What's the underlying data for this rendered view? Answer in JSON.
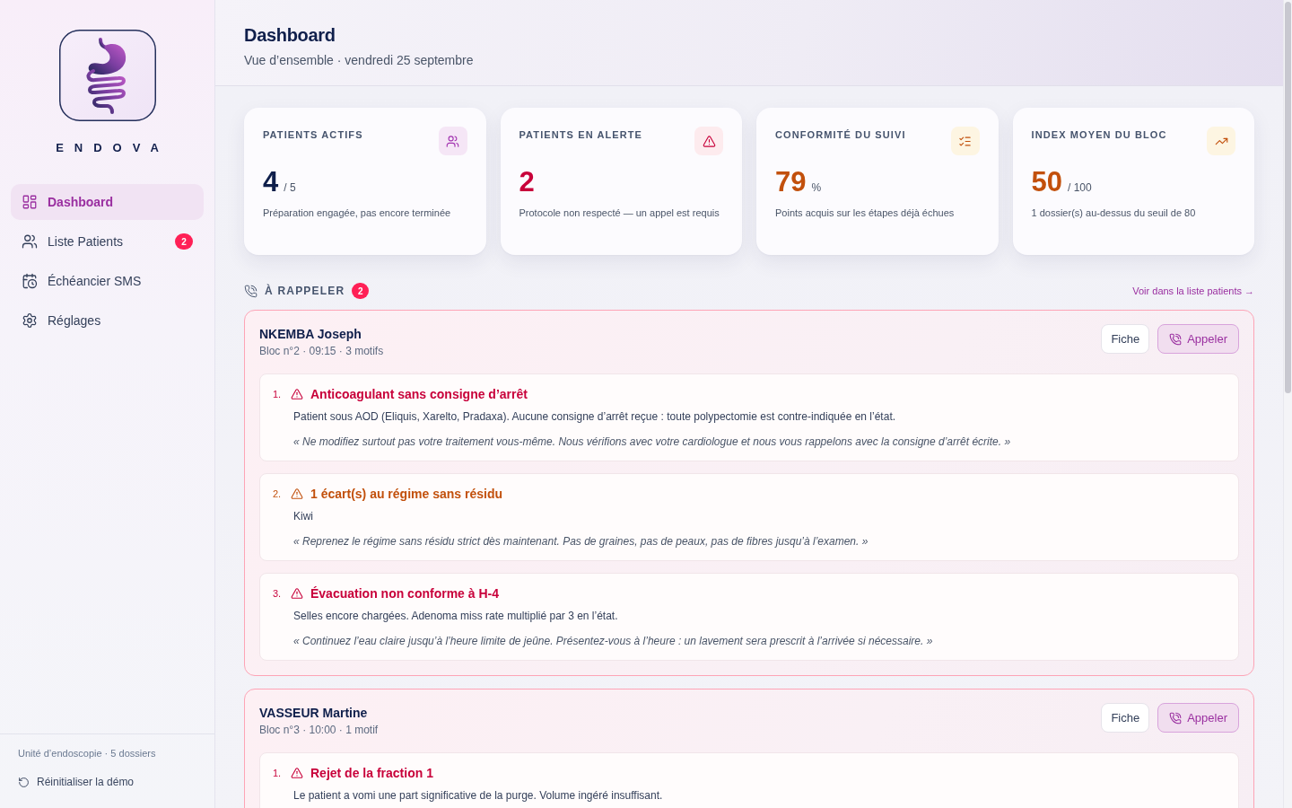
{
  "sidebar": {
    "brand": "ENDOVA",
    "nav": [
      {
        "label": "Dashboard",
        "selected": true
      },
      {
        "label": "Liste Patients",
        "selected": false,
        "badge": "2"
      },
      {
        "label": "Échéancier SMS",
        "selected": false
      },
      {
        "label": "Réglages",
        "selected": false
      }
    ],
    "footer": {
      "unit": "Unité d’endoscopie · 5 dossiers",
      "reset": "Réinitialiser la démo"
    }
  },
  "header": {
    "title": "Dashboard",
    "subtitle": "Vue d’ensemble · vendredi 25 septembre"
  },
  "stats": [
    {
      "kind": "patients",
      "label": "PATIENTS ACTIFS",
      "value": "4",
      "unit": "/ 5",
      "description": "Préparation engagée, pas encore terminée"
    },
    {
      "kind": "alert",
      "label": "PATIENTS EN ALERTE",
      "value": "2",
      "description": "Protocole non respecté — un appel est requis"
    },
    {
      "kind": "compliance",
      "label": "CONFORMITÉ DU SUIVI",
      "value": "79",
      "unit": "%",
      "description": "Points acquis sur les étapes déjà échues"
    },
    {
      "kind": "index",
      "label": "INDEX MOYEN DU BLOC",
      "value": "50",
      "unit": "/ 100",
      "description": "1 dossier(s) au-dessus du seuil de 80"
    }
  ],
  "callbacks": {
    "title": "À RAPPELER",
    "count": "2",
    "link": "Voir dans la liste patients →",
    "patients": [
      {
        "name": "NKEMBA Joseph",
        "meta": "Bloc n°2 · 09:15 · 3 motifs",
        "sheet_button": "Fiche",
        "call_button": "Appeler",
        "issues": [
          {
            "number": "1.",
            "kind": "critical",
            "title": "Anticoagulant sans consigne d’arrêt",
            "detail": "Patient sous AOD (Eliquis, Xarelto, Pradaxa). Aucune consigne d’arrêt reçue : toute polypectomie est contre-indiquée en l’état.",
            "quote": "« Ne modifiez surtout pas votre traitement vous-même. Nous vérifions avec votre cardiologue et nous vous rappelons avec la consigne d’arrêt écrite. »"
          },
          {
            "number": "2.",
            "kind": "warning",
            "title": "1 écart(s) au régime sans résidu",
            "detail": "Kiwi",
            "quote": "« Reprenez le régime sans résidu strict dès maintenant. Pas de graines, pas de peaux, pas de fibres jusqu’à l’examen. »"
          },
          {
            "number": "3.",
            "kind": "critical",
            "title": "Évacuation non conforme à H-4",
            "detail": "Selles encore chargées. Adenoma miss rate multiplié par 3 en l’état.",
            "quote": "« Continuez l’eau claire jusqu’à l’heure limite de jeûne. Présentez-vous à l’heure : un lavement sera prescrit à l’arrivée si nécessaire. »"
          }
        ]
      },
      {
        "name": "VASSEUR Martine",
        "meta": "Bloc n°3 · 10:00 · 1 motif",
        "sheet_button": "Fiche",
        "call_button": "Appeler",
        "issues": [
          {
            "number": "1.",
            "kind": "critical",
            "title": "Rejet de la fraction 1",
            "detail": "Le patient a vomi une part significative de la purge. Volume ingéré insuffisant."
          }
        ]
      }
    ]
  }
}
